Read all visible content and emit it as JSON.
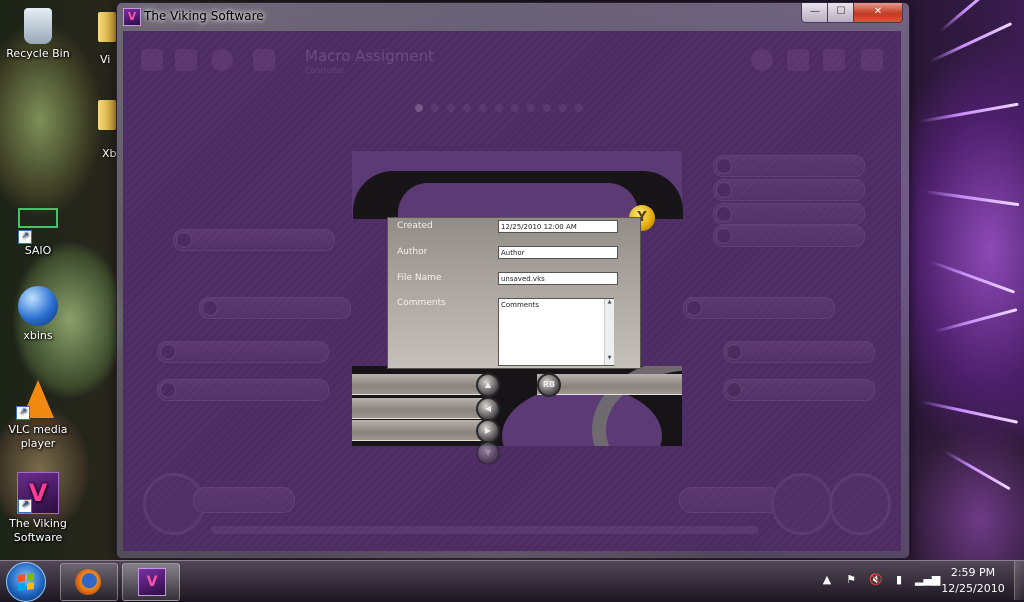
{
  "desktop": {
    "icons": [
      {
        "label": "Recycle Bin",
        "icon": "recycle-bin-icon"
      },
      {
        "label": "SAIO",
        "icon": "saio-icon"
      },
      {
        "label": "xbins",
        "icon": "globe-icon"
      },
      {
        "label": "VLC media player",
        "icon": "vlc-cone-icon"
      },
      {
        "label": "The Viking Software",
        "icon": "viking-v-icon"
      }
    ],
    "partial_labels": [
      "Vi",
      "Xb"
    ]
  },
  "window": {
    "title": "The Viking Software",
    "app_icon_glyph": "V",
    "caption": {
      "minimize": "—",
      "maximize": "☐",
      "close": "✕"
    }
  },
  "app": {
    "header_title": "Macro Assigment",
    "header_subtitle": "Controller",
    "form": {
      "created_label": "Created",
      "created_value": "12/25/2010 12:00 AM",
      "author_label": "Author",
      "author_value": "Author",
      "filename_label": "File Name",
      "filename_value": "unsaved.vks",
      "comments_label": "Comments",
      "comments_value": "Comments"
    },
    "mapping_buttons": [
      {
        "glyph": "▲",
        "icon": "dpad-up-icon"
      },
      {
        "glyph": "◀",
        "icon": "dpad-left-icon"
      },
      {
        "glyph": "▶",
        "icon": "dpad-right-icon"
      },
      {
        "glyph": "▼",
        "icon": "dpad-down-icon"
      },
      {
        "glyph": "RB",
        "icon": "right-bumper-icon"
      }
    ],
    "y_button": "Y"
  },
  "taskbar": {
    "time": "2:59 PM",
    "date": "12/25/2010",
    "tray": [
      "show-hidden-icons-icon",
      "action-center-flag-icon",
      "volume-muted-icon",
      "battery-icon",
      "signal-bars-icon"
    ]
  },
  "colors": {
    "app_background": "#4d2b63",
    "form_panel": "#a9a39d",
    "close_button": "#c23b22",
    "y_button": "#e2a800"
  }
}
